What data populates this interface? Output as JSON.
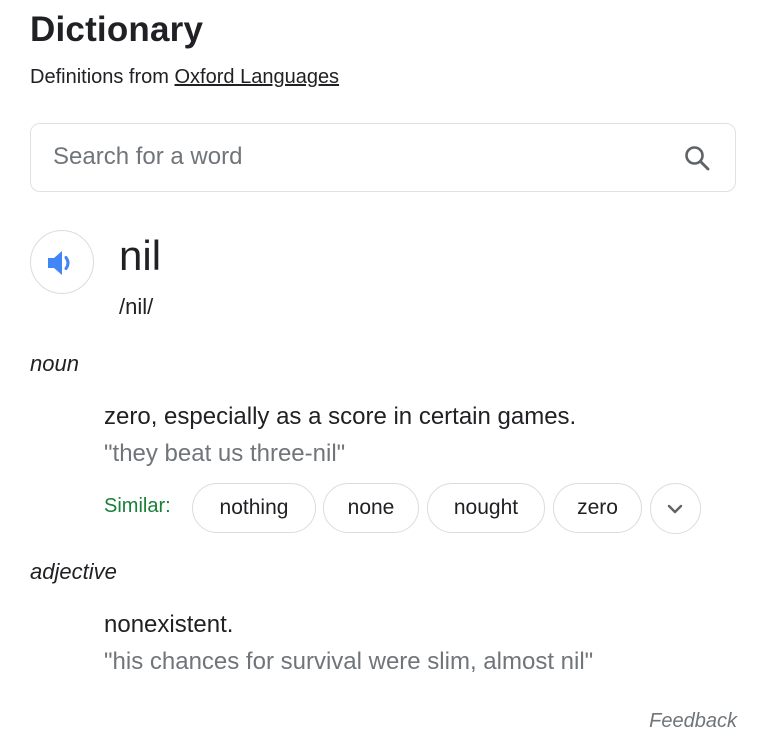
{
  "header": {
    "title": "Dictionary",
    "source_prefix": "Definitions from",
    "source_link": "Oxford Languages"
  },
  "search": {
    "placeholder": "Search for a word",
    "value": "",
    "icon": "search-icon"
  },
  "entry": {
    "word": "nil",
    "phonetic": "/nil/",
    "audio_icon": "speaker-icon"
  },
  "senses": [
    {
      "part_of_speech": "noun",
      "definition": "zero, especially as a score in certain games.",
      "example": "\"they beat us three-nil\"",
      "similar_label": "Similar:",
      "similar": [
        "nothing",
        "none",
        "nought",
        "zero"
      ]
    },
    {
      "part_of_speech": "adjective",
      "definition": "nonexistent.",
      "example": "\"his chances for survival were slim, almost nil\""
    }
  ],
  "footer": {
    "feedback": "Feedback"
  },
  "colors": {
    "speaker_blue": "#4285f4",
    "similar_green": "#188038",
    "muted_gray": "#70757a",
    "border_gray": "#dadce0"
  }
}
